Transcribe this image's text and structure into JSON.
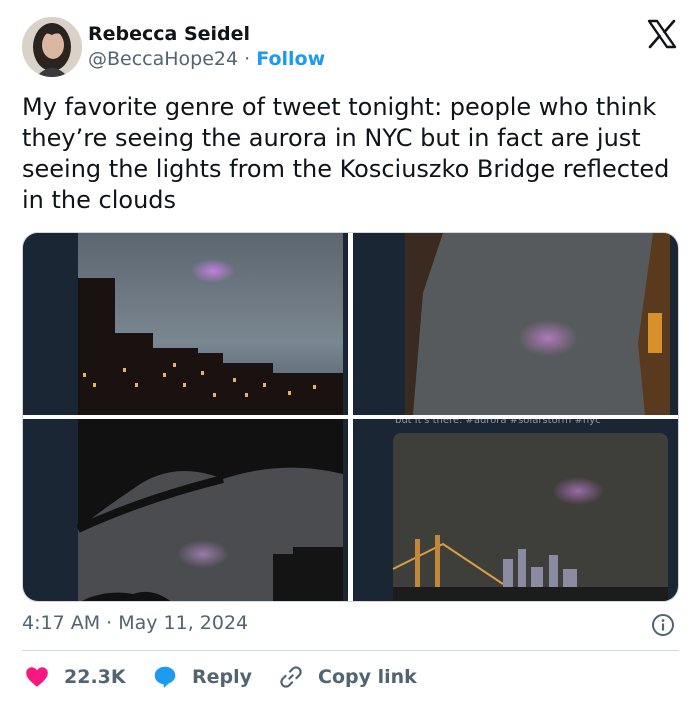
{
  "author": {
    "name": "Rebecca Seidel",
    "handle": "@BeccaHope24",
    "separator": " · ",
    "follow_label": "Follow"
  },
  "tweet": {
    "text": "My favorite genre of tweet tonight: people who think they’re seeing the aurora in NYC but in fact are just seeing the lights from the Kosciuszko Bridge reflected in the clouds"
  },
  "media": {
    "image_4_caption": "but it's there. #aurora #solarstorm #nyc"
  },
  "meta": {
    "timestamp": "4:17 AM · May 11, 2024"
  },
  "actions": {
    "likes": "22.3K",
    "reply_label": "Reply",
    "copy_label": "Copy link"
  },
  "colors": {
    "like": "#f91880",
    "link": "#1d9bf0",
    "muted": "#536471",
    "border": "#cfd9de"
  },
  "icons": {
    "platform": "x-logo-icon",
    "info": "info-icon",
    "like": "heart-icon",
    "reply": "speech-bubble-icon",
    "copy": "link-icon"
  }
}
